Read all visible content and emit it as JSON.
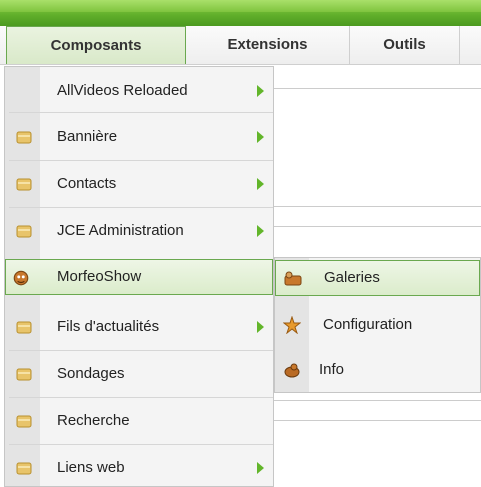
{
  "menubar": {
    "tabs": [
      {
        "label": "Composants",
        "active": true
      },
      {
        "label": "Extensions",
        "active": false
      },
      {
        "label": "Outils",
        "active": false
      }
    ]
  },
  "dropdown": {
    "items": [
      {
        "label": "AllVideos Reloaded",
        "icon": "none",
        "has_submenu": true
      },
      {
        "label": "Bannière",
        "icon": "folder-icon",
        "has_submenu": true
      },
      {
        "label": "Contacts",
        "icon": "folder-icon",
        "has_submenu": true
      },
      {
        "label": "JCE Administration",
        "icon": "folder-icon",
        "has_submenu": true
      },
      {
        "label": "MorfeoShow",
        "icon": "morfeo-icon",
        "has_submenu": false,
        "highlighted": true
      },
      {
        "label": "Fils d'actualités",
        "icon": "folder-icon",
        "has_submenu": true
      },
      {
        "label": "Sondages",
        "icon": "folder-icon",
        "has_submenu": false
      },
      {
        "label": "Recherche",
        "icon": "folder-icon",
        "has_submenu": false
      },
      {
        "label": "Liens web",
        "icon": "folder-icon",
        "has_submenu": true
      }
    ]
  },
  "submenu": {
    "items": [
      {
        "label": "Galeries",
        "icon": "gallery-icon",
        "highlighted": true
      },
      {
        "label": "Configuration",
        "icon": "configuration-icon"
      },
      {
        "label": "Info",
        "icon": "info-icon"
      }
    ]
  },
  "colors": {
    "accent_green": "#6aa84f",
    "arrow_green": "#62b52a",
    "topbar_green": "#5fae2a"
  }
}
